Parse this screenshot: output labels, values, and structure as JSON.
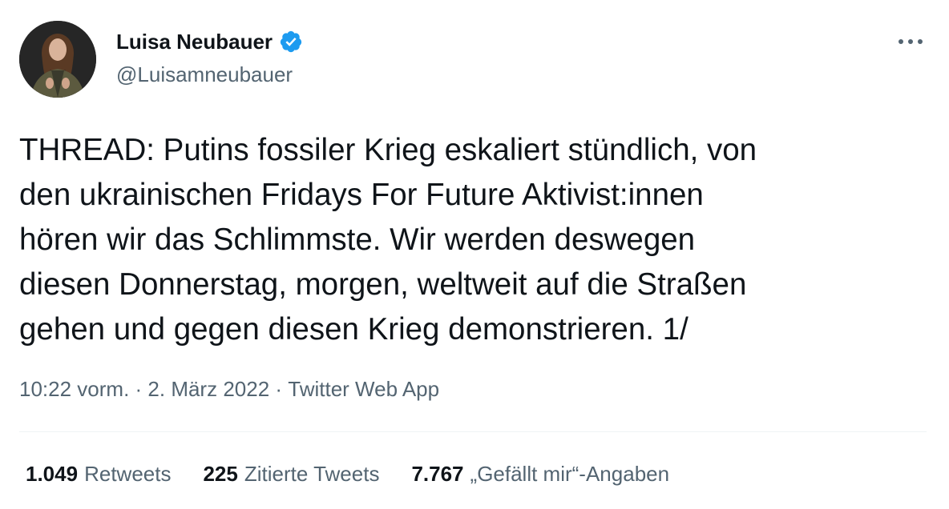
{
  "author": {
    "display_name": "Luisa Neubauer",
    "handle": "@Luisamneubauer",
    "verified": true,
    "avatar_icon": "avatar-photo"
  },
  "tweet": {
    "text": "THREAD: Putins fossiler Krieg eskaliert stündlich, von\nden ukrainischen Fridays For Future Aktivist:innen\nhören wir das Schlimmste. Wir werden deswegen\ndiesen Donnerstag, morgen, weltweit auf die Straßen\ngehen und gegen diesen Krieg demonstrieren. 1/"
  },
  "meta": {
    "time": "10:22 vorm.",
    "separator": " · ",
    "date": "2. März 2022",
    "source": "Twitter Web App"
  },
  "stats": {
    "retweets_count": "1.049",
    "retweets_label": "Retweets",
    "quotes_count": "225",
    "quotes_label": "Zitierte Tweets",
    "likes_count": "7.767",
    "likes_label": "„Gefällt mir“-Angaben"
  },
  "colors": {
    "text_primary": "#0f1419",
    "text_secondary": "#536471",
    "verified_blue": "#1d9bf0",
    "divider": "#eff3f4"
  },
  "icons": {
    "more": "more-dots-icon",
    "verified": "verified-badge-icon"
  }
}
